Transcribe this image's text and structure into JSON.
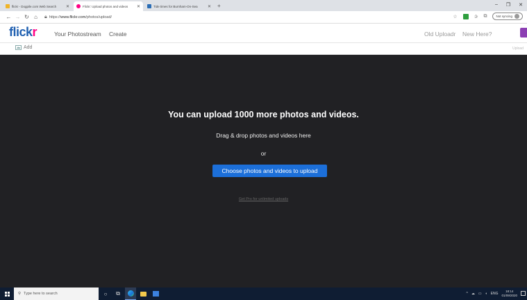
{
  "browser": {
    "tabs": [
      {
        "title": "flickr - Dogpile.com Web Search",
        "favicon_color": "#f0b428",
        "active": false
      },
      {
        "title": "Flickr: Upload photos and videos",
        "favicon_color": "#ff0084",
        "active": true
      },
      {
        "title": "Tide times for Burnham-On-Sea",
        "favicon_color": "#2a6db5",
        "active": false
      }
    ],
    "new_tab_label": "+",
    "url_prefix": "https://",
    "url_host": "www.flickr.com",
    "url_path": "/photos/upload/",
    "profile_label": "Not syncing",
    "window_controls": {
      "minimize": "–",
      "maximize": "❐",
      "close": "✕"
    }
  },
  "flickr": {
    "logo_blue": "flick",
    "logo_pink": "r",
    "nav": {
      "photostream": "Your Photostream",
      "create": "Create",
      "old_uploadr": "Old Uploadr",
      "new_here": "New Here?"
    },
    "toolbar": {
      "add_label": "Add",
      "upload_label": "Upload"
    },
    "upload": {
      "headline": "You can upload 1000 more photos and videos.",
      "drag_text": "Drag & drop photos and videos here",
      "or_text": "or",
      "choose_button": "Choose photos and videos to upload",
      "get_pro": "Get Pro for unlimited uploads"
    }
  },
  "taskbar": {
    "search_placeholder": "Type here to search",
    "tray_lang": "ENG",
    "clock_time": "18:14",
    "clock_date": "01/09/2020"
  },
  "colors": {
    "flickr_blue": "#1f5fb0",
    "flickr_pink": "#ff0084",
    "stage_bg": "#212124",
    "button_blue": "#1c6fd9",
    "taskbar_bg": "#0f1d33"
  }
}
